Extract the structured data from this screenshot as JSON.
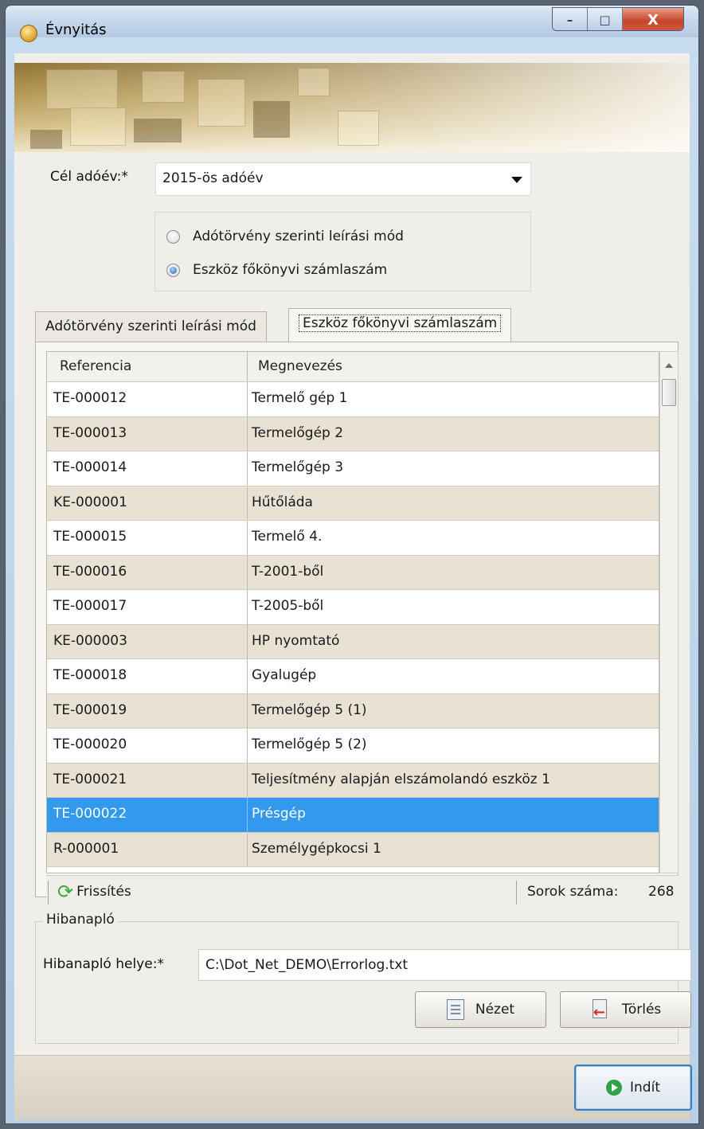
{
  "window": {
    "title": "Évnyitás",
    "minimize_glyph": "–",
    "maximize_glyph": "□",
    "close_glyph": "X"
  },
  "target_year": {
    "label": "Cél adóév:*",
    "value": "2015-ös adóév"
  },
  "radio_options": [
    {
      "label": "Adótörvény szerinti leírási mód",
      "selected": false
    },
    {
      "label": "Eszköz főkönyvi számlaszám",
      "selected": true
    }
  ],
  "tabs": [
    {
      "label": "Adótörvény szerinti leírási mód",
      "active": false
    },
    {
      "label": "Eszköz főkönyvi számlaszám",
      "active": true
    }
  ],
  "grid": {
    "columns": [
      "Referencia",
      "Megnevezés"
    ],
    "rows": [
      {
        "ref": "TE-000012",
        "name": "Termelő gép 1"
      },
      {
        "ref": "TE-000013",
        "name": "Termelőgép 2"
      },
      {
        "ref": "TE-000014",
        "name": "Termelőgép 3"
      },
      {
        "ref": "KE-000001",
        "name": "Hűtőláda"
      },
      {
        "ref": "TE-000015",
        "name": "Termelő 4."
      },
      {
        "ref": "TE-000016",
        "name": "T-2001-ből"
      },
      {
        "ref": "TE-000017",
        "name": "T-2005-ből"
      },
      {
        "ref": "KE-000003",
        "name": "HP nyomtató"
      },
      {
        "ref": "TE-000018",
        "name": "Gyalugép"
      },
      {
        "ref": "TE-000019",
        "name": "Termelőgép 5 (1)"
      },
      {
        "ref": "TE-000020",
        "name": "Termelőgép 5 (2)"
      },
      {
        "ref": "TE-000021",
        "name": "Teljesítmény alapján elszámolandó eszköz 1"
      },
      {
        "ref": "TE-000022",
        "name": "Présgép",
        "selected": true
      },
      {
        "ref": "R-000001",
        "name": "Személygépkocsi 1"
      }
    ]
  },
  "statusbar": {
    "refresh_label": "Frissítés",
    "row_count_label": "Sorok száma:",
    "row_count": "268"
  },
  "error_log": {
    "group_title": "Hibanapló",
    "path_label": "Hibanapló helye:*",
    "path_value": "C:\\Dot_Net_DEMO\\Errorlog.txt",
    "view_label": "Nézet",
    "delete_label": "Törlés"
  },
  "start_label": "Indít",
  "colors": {
    "selection": "#3399ee",
    "alt_row": "#e8e2d5",
    "accent_border": "#3c7fc0"
  }
}
